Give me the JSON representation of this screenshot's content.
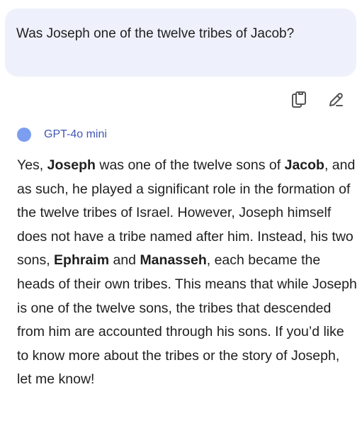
{
  "user_message": {
    "text": "Was Joseph one of the twelve tribes of Jacob?"
  },
  "actions": {
    "copy_icon": "copy-icon",
    "edit_icon": "edit-pencil-icon"
  },
  "model": {
    "name": "GPT-4o mini",
    "accent_color": "#7c9ef0"
  },
  "response": {
    "s1": "Yes, ",
    "b1": "Joseph",
    "s2": " was one of the twelve sons of ",
    "b2": "Jacob",
    "s3": ", and as such, he played a significant role in the formation of the twelve tribes of Israel. However, Joseph himself does not have a tribe named after him. Instead, his two sons, ",
    "b3": "Ephraim",
    "s4": " and ",
    "b4": "Manasseh",
    "s5": ", each became the heads of their own tribes. This means that while Joseph is one of the twelve sons, the tribes that descended from him are accounted through his sons. If you’d like to know more about the tribes or the story of Joseph, let me know!"
  }
}
